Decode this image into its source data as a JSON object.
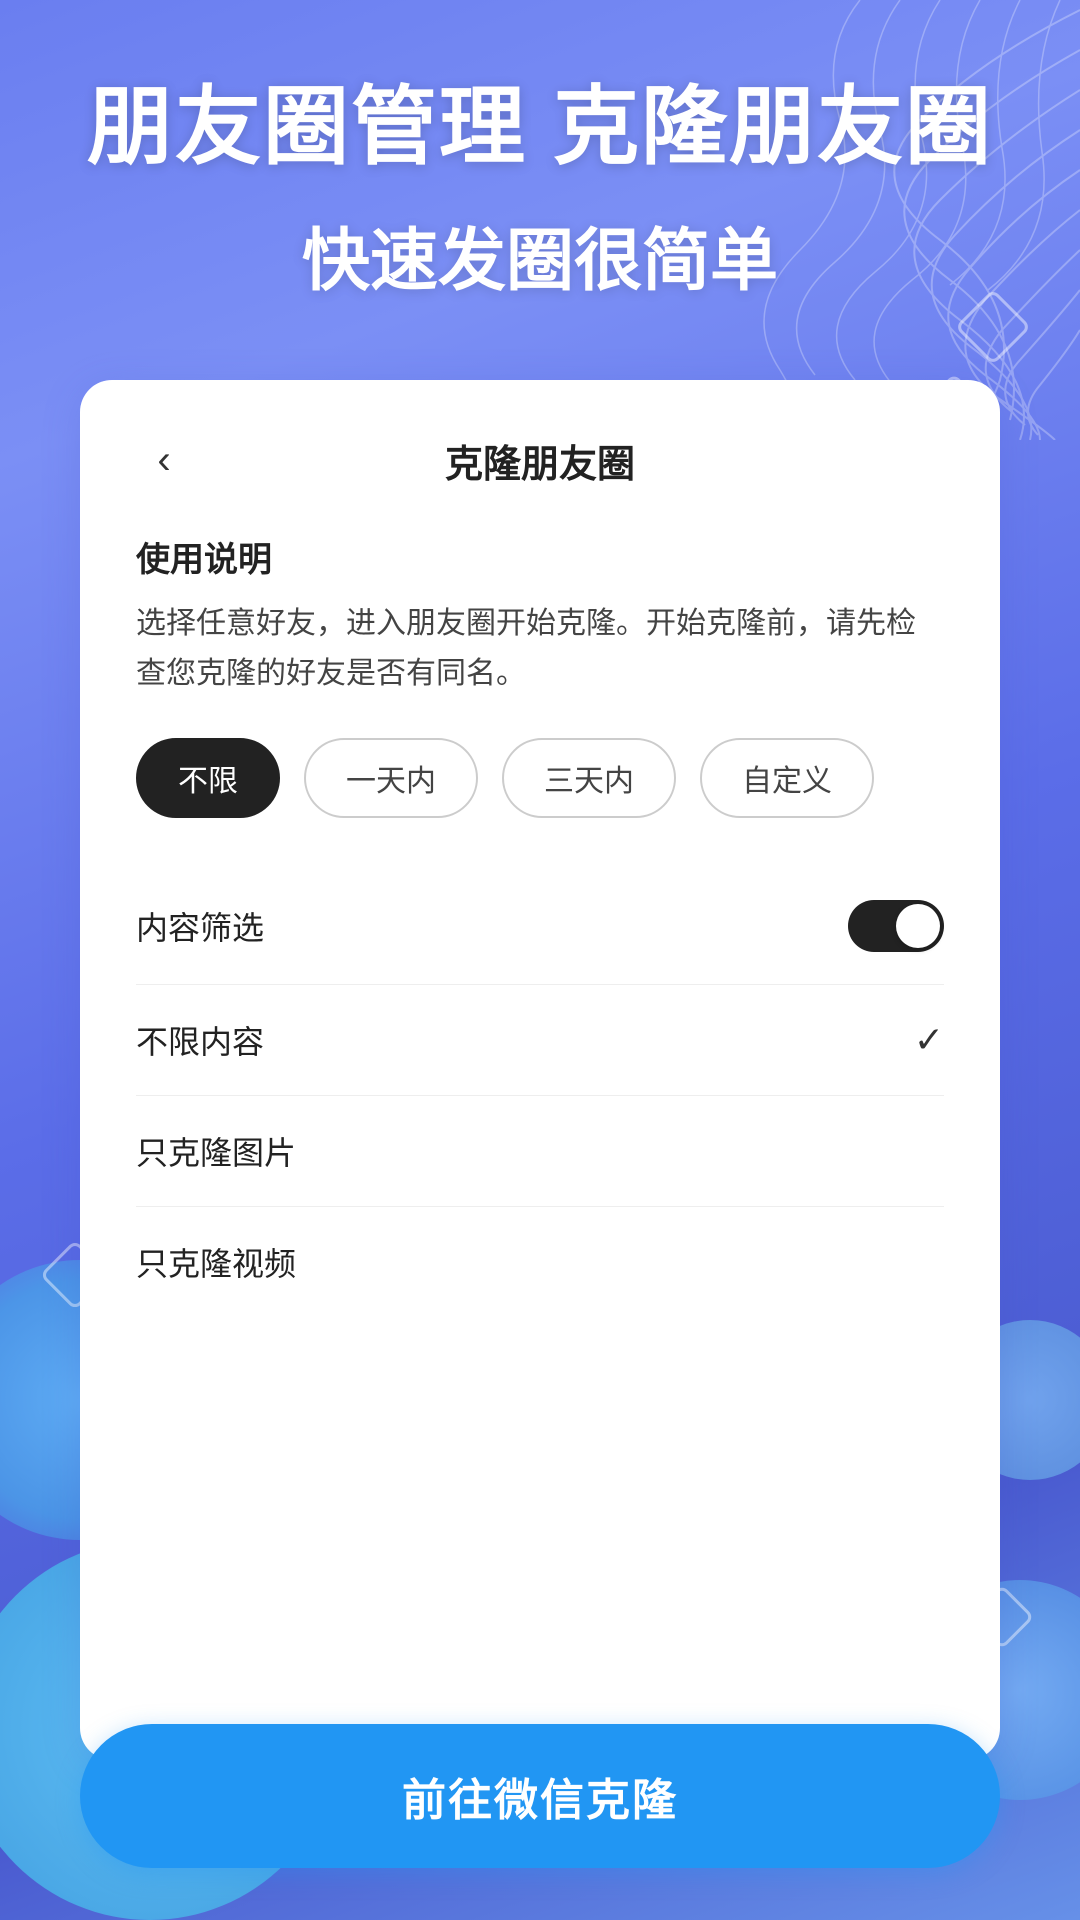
{
  "background": {
    "color_start": "#6a7ef0",
    "color_end": "#5b6de8"
  },
  "header": {
    "title_line1": "朋友圈管理 克隆朋友圈",
    "title_line2": "快速发圈很简单"
  },
  "card": {
    "back_label": "‹",
    "card_title": "克隆朋友圈",
    "instructions_title": "使用说明",
    "instructions_desc": "选择任意好友，进入朋友圈开始克隆。开始克隆前，请先检查您克隆的好友是否有同名。",
    "filter_buttons": [
      {
        "label": "不限",
        "active": true
      },
      {
        "label": "一天内",
        "active": false
      },
      {
        "label": "三天内",
        "active": false
      },
      {
        "label": "自定义",
        "active": false
      }
    ],
    "content_filter_label": "内容筛选",
    "toggle_on": true,
    "options": [
      {
        "label": "不限内容",
        "checked": true
      },
      {
        "label": "只克隆图片",
        "checked": false
      },
      {
        "label": "只克隆视频",
        "checked": false
      }
    ],
    "go_button_label": "前往微信克隆"
  }
}
